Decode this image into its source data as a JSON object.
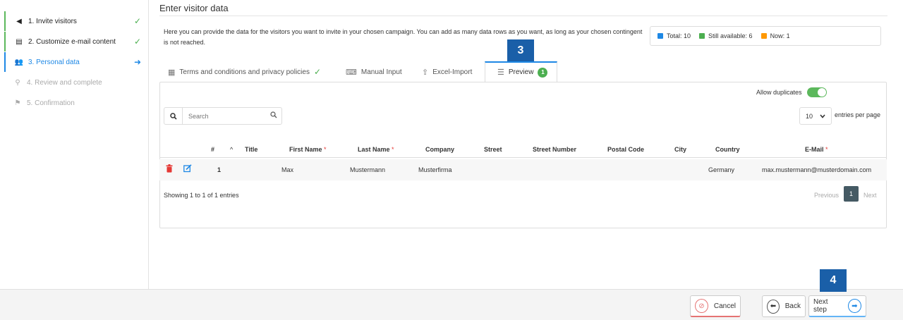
{
  "sidebar": {
    "steps": [
      {
        "label": "1. Invite visitors",
        "icon": "megaphone-icon",
        "glyph": "◀",
        "status": "✓"
      },
      {
        "label": "2. Customize e-mail content",
        "icon": "message-icon",
        "glyph": "▤",
        "status": "✓"
      },
      {
        "label": "3. Personal data",
        "icon": "users-icon",
        "glyph": "👥",
        "status": "➜"
      },
      {
        "label": "4. Review and complete",
        "icon": "search-icon",
        "glyph": "⚲",
        "status": ""
      },
      {
        "label": "5. Confirmation",
        "icon": "flag-icon",
        "glyph": "⚑",
        "status": ""
      }
    ]
  },
  "header": {
    "title": "Enter visitor data",
    "intro": "Here you can provide the data for the visitors you want to invite in your chosen campaign. You can add as many data rows as you want, as long as your chosen contingent is not reached."
  },
  "counts": {
    "total": "Total: 10",
    "available": "Still available: 6",
    "now": "Now: 1",
    "colors": {
      "total": "#1e88e5",
      "available": "#4caf50",
      "now": "#ff9800"
    }
  },
  "markers": {
    "tabs": "3",
    "next": "4"
  },
  "tabs": [
    {
      "label": "Terms and conditions and privacy policies",
      "icon": "document-icon",
      "glyph": "▦",
      "check": "✓"
    },
    {
      "label": "Manual Input",
      "icon": "keyboard-icon",
      "glyph": "⌨"
    },
    {
      "label": "Excel-Import",
      "icon": "upload-icon",
      "glyph": "⇪"
    },
    {
      "label": "Preview",
      "icon": "list-icon",
      "glyph": "☰",
      "badge": "1"
    }
  ],
  "options": {
    "allow_duplicates": "Allow duplicates"
  },
  "search": {
    "placeholder": "Search"
  },
  "paging": {
    "entries_value": "10",
    "entries_label": "entries per page",
    "showing": "Showing 1 to 1 of 1 entries",
    "previous": "Previous",
    "current": "1",
    "next": "Next"
  },
  "table": {
    "headers": {
      "num": "#",
      "title": "Title",
      "first_name": "First Name",
      "last_name": "Last Name",
      "company": "Company",
      "street": "Street",
      "street_number": "Street Number",
      "postal_code": "Postal Code",
      "city": "City",
      "country": "Country",
      "email": "E-Mail"
    },
    "required_mark": "*",
    "rows": [
      {
        "num": "1",
        "title": "",
        "first_name": "Max",
        "last_name": "Mustermann",
        "company": "Musterfirma",
        "street": "",
        "street_number": "",
        "postal_code": "",
        "city": "",
        "country": "Germany",
        "email": "max.mustermann@musterdomain.com"
      }
    ]
  },
  "footer": {
    "cancel": "Cancel",
    "back": "Back",
    "next": "Next step"
  }
}
